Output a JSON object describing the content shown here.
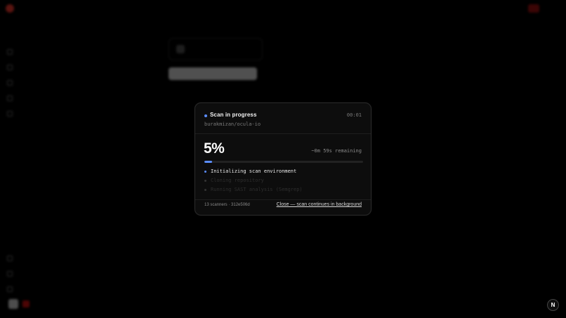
{
  "colors": {
    "accent": "#5b8dff",
    "brand": "#ff3b2f",
    "modal_bg": "#0d0d0d",
    "page_bg": "#000000"
  },
  "modal": {
    "title": "Scan in progress",
    "timer": "00:01",
    "repo": "burakmizan/ocula-io",
    "percent_label": "5%",
    "progress": 0.05,
    "remaining": "~0m 59s remaining",
    "steps": [
      {
        "label": "Initializing scan environment",
        "state": "active"
      },
      {
        "label": "Cloning repository",
        "state": "pending"
      },
      {
        "label": "Running SAST analysis (Semgrep)",
        "state": "pending"
      }
    ],
    "meta": "13 scanners · 312e506d",
    "close_label": "Close — scan continues in background"
  },
  "fab": {
    "label": "N"
  },
  "icons": [
    "status-dot-icon",
    "help-badge-icon"
  ]
}
